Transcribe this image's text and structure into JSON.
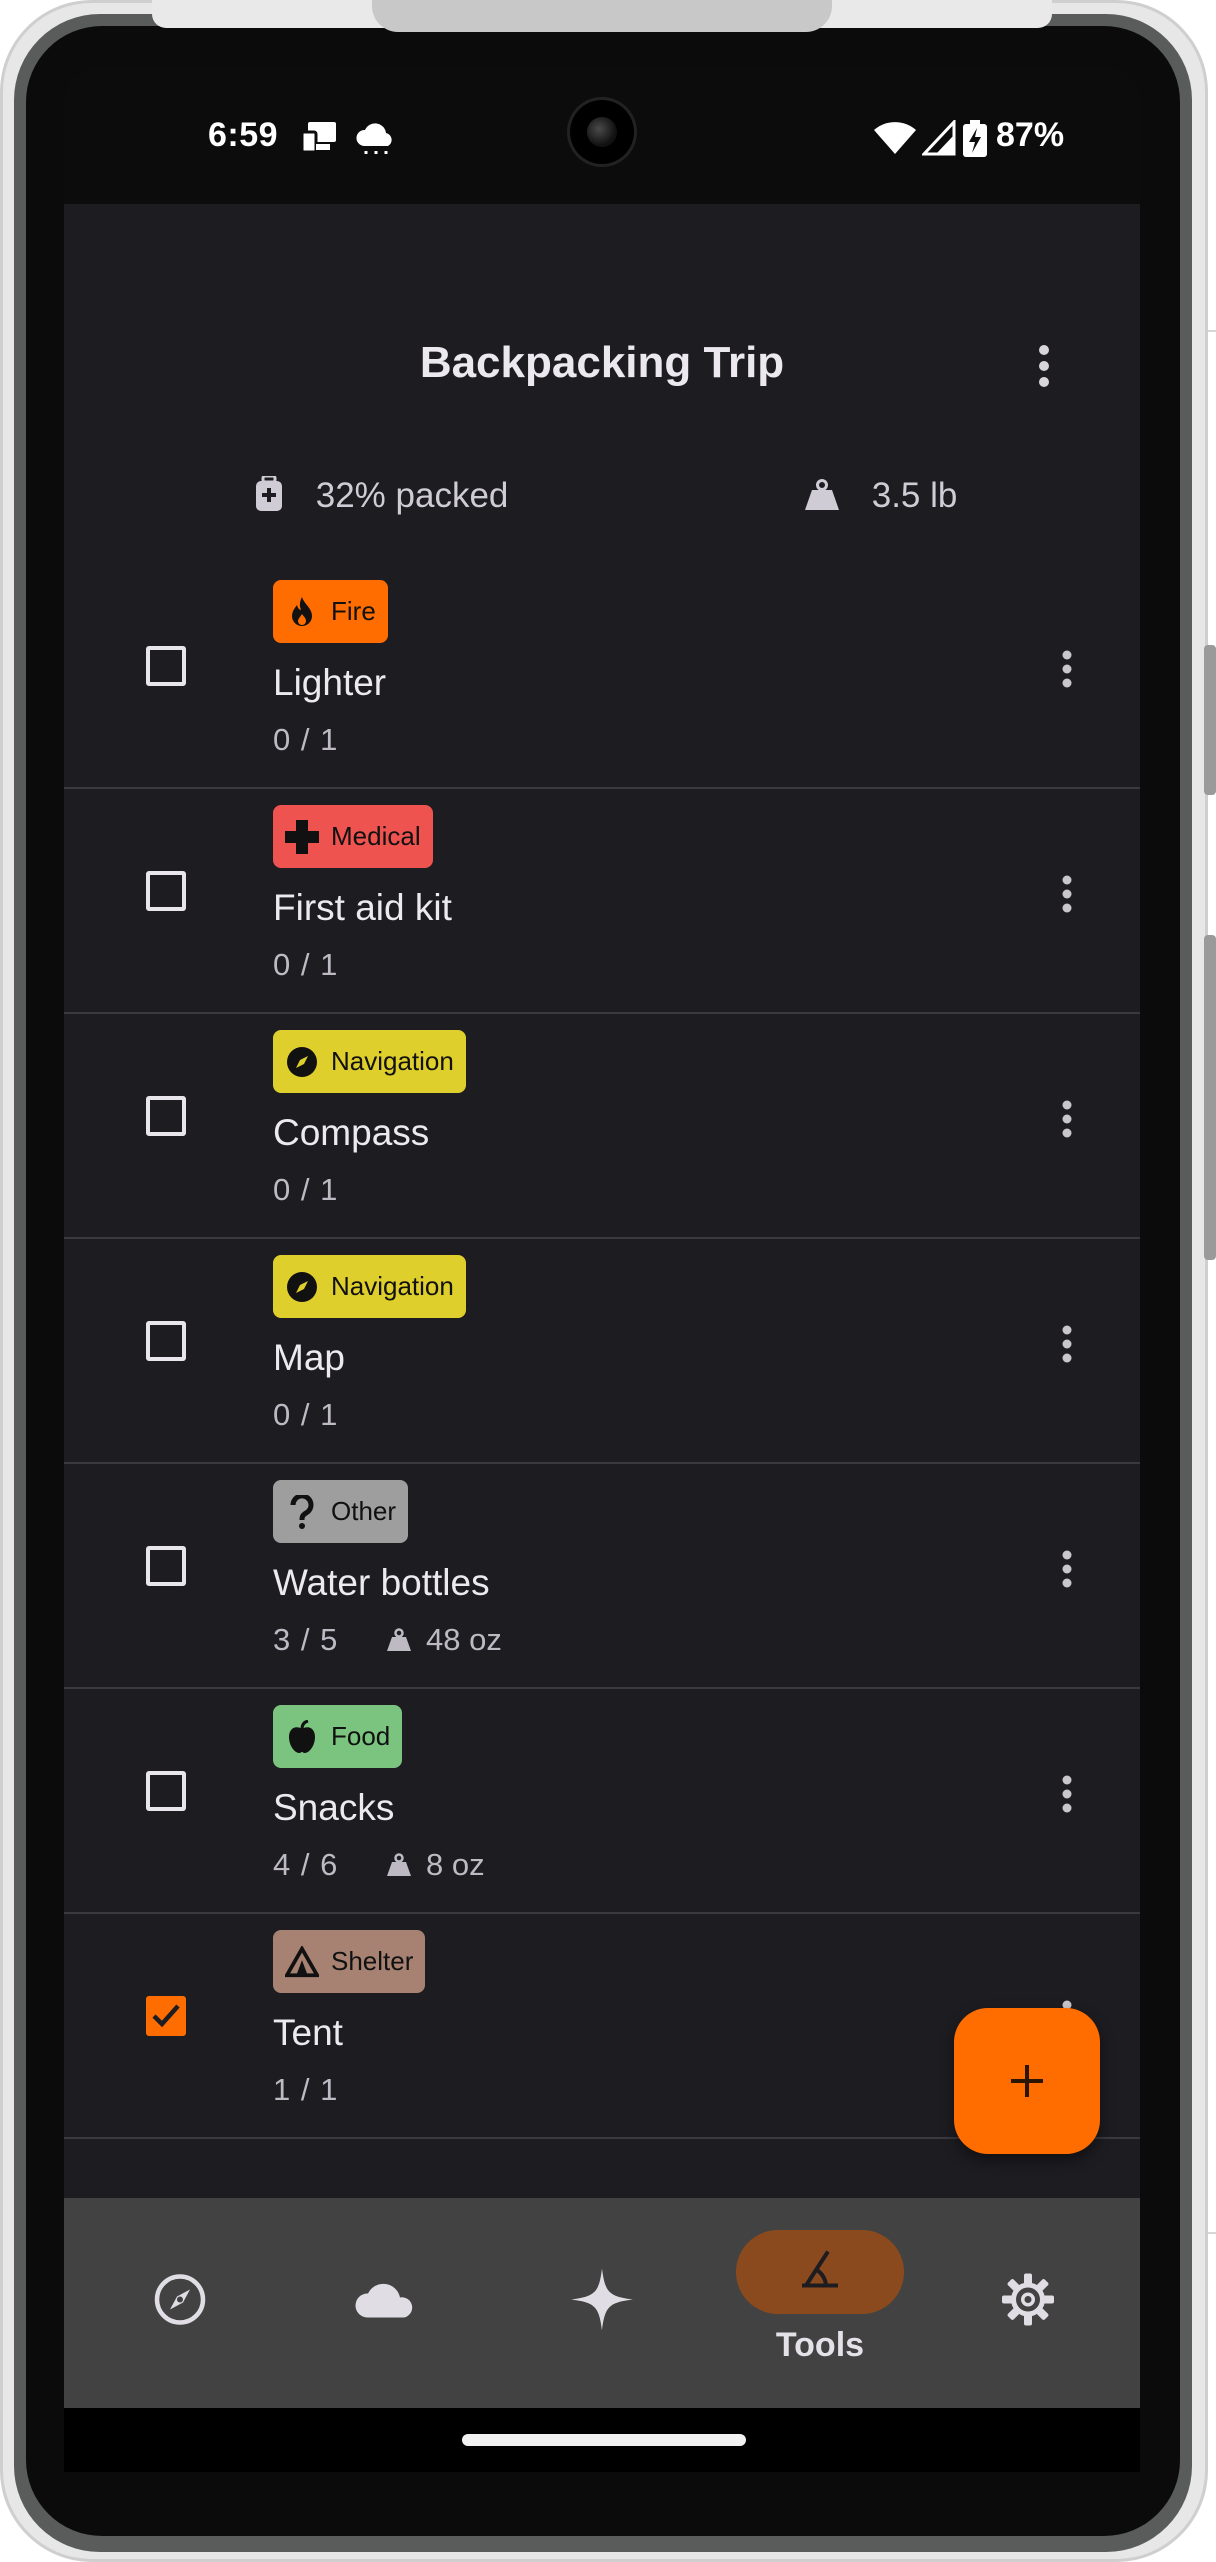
{
  "status_bar": {
    "time": "6:59",
    "battery": "87%",
    "left_icons": [
      "cast-icon",
      "cloud-icon"
    ],
    "right_icons": [
      "wifi-icon",
      "signal-icon",
      "battery-charging-icon"
    ]
  },
  "header": {
    "title": "Backpacking Trip",
    "packed_label": "32% packed",
    "packed_fraction": 0.32,
    "weight_label": "3.5 lb"
  },
  "items": [
    {
      "category": "Fire",
      "category_color": "#ff6d00",
      "icon": "flame-icon",
      "name": "Lighter",
      "count": "0 / 1",
      "weight": "",
      "checked": false
    },
    {
      "category": "Medical",
      "category_color": "#ef5350",
      "icon": "medical-cross-icon",
      "name": "First aid kit",
      "count": "0 / 1",
      "weight": "",
      "checked": false
    },
    {
      "category": "Navigation",
      "category_color": "#dfcf2c",
      "icon": "compass-icon",
      "name": "Compass",
      "count": "0 / 1",
      "weight": "",
      "checked": false
    },
    {
      "category": "Navigation",
      "category_color": "#dfcf2c",
      "icon": "compass-icon",
      "name": "Map",
      "count": "0 / 1",
      "weight": "",
      "checked": false
    },
    {
      "category": "Other",
      "category_color": "#9e9e9e",
      "icon": "question-icon",
      "name": "Water bottles",
      "count": "3 / 5",
      "weight": "48 oz",
      "checked": false
    },
    {
      "category": "Food",
      "category_color": "#7ac47f",
      "icon": "apple-icon",
      "name": "Snacks",
      "count": "4 / 6",
      "weight": "8 oz",
      "checked": false
    },
    {
      "category": "Shelter",
      "category_color": "#a78273",
      "icon": "tent-icon",
      "name": "Tent",
      "count": "1 / 1",
      "weight": "",
      "checked": true
    }
  ],
  "colors": {
    "accent": "#ff6d00",
    "background": "#1d1c21",
    "nav_background": "#424242",
    "nav_active_pill": "#8a4a1d"
  },
  "fab": {
    "icon": "plus-icon"
  },
  "bottom_nav": {
    "items": [
      {
        "icon": "compass-icon",
        "label": "",
        "active": false
      },
      {
        "icon": "cloud-icon",
        "label": "",
        "active": false
      },
      {
        "icon": "sparkle-icon",
        "label": "",
        "active": false
      },
      {
        "icon": "tools-icon",
        "label": "Tools",
        "active": true
      },
      {
        "icon": "gear-icon",
        "label": "",
        "active": false
      }
    ]
  }
}
